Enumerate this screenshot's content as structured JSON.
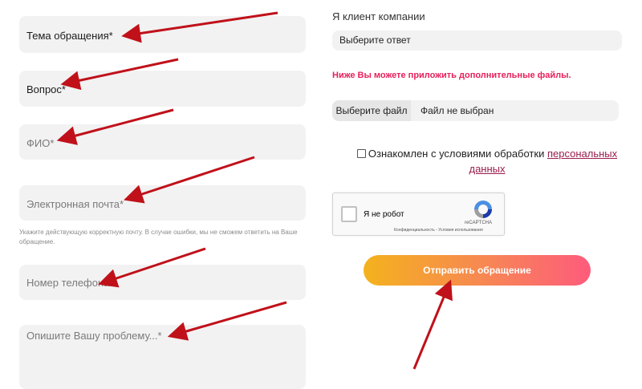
{
  "form": {
    "topic_placeholder": "Тема обращения*",
    "question_placeholder": "Вопрос*",
    "name_placeholder": "ФИО*",
    "email_placeholder": "Электронная почта*",
    "email_hint": "Укажите действующую корректную почту. В случае ошибки, мы не сможем ответить на Ваше обращение.",
    "phone_placeholder": "Номер телефона*",
    "problem_placeholder": "Опишите Вашу проблему...*"
  },
  "client": {
    "label": "Я клиент компании",
    "select_value": "Выберите ответ"
  },
  "attachments": {
    "note": "Ниже Вы можете приложить дополнительные файлы.",
    "choose_button": "Выберите файл",
    "status": "Файл не выбран"
  },
  "consent": {
    "text": "Ознакомлен с условиями обработки ",
    "link_text": "персональных данных"
  },
  "captcha": {
    "label": "Я не робот",
    "brand": "reCAPTCHA",
    "terms": "Конфиденциальность - Условия использования"
  },
  "submit": {
    "label": "Отправить обращение"
  },
  "colors": {
    "accent_pink": "#e8205c",
    "link": "#9a1d4c",
    "arrow": "#c0111a",
    "button_gradient_start": "#f4b21d",
    "button_gradient_end": "#fe5b7c"
  }
}
